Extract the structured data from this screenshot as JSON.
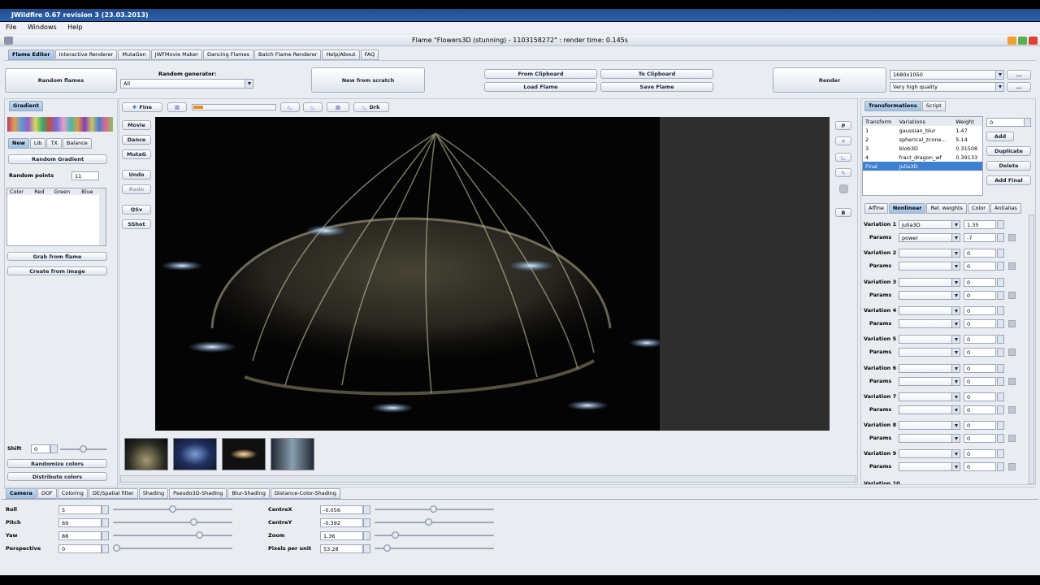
{
  "window": {
    "title": "JWildfire 0.67 revision 3 (23.03.2013)",
    "frame_title": "Flame \"Flowers3D (stunning) - 1103158272\" : render time: 0.145s"
  },
  "menu": [
    "File",
    "Windows",
    "Help"
  ],
  "main_tabs": [
    "Flame Editor",
    "Interactive Renderer",
    "MutaGen",
    "JWFMovie Maker",
    "Dancing Flames",
    "Batch Flame Renderer",
    "Help/About",
    "FAQ"
  ],
  "top": {
    "random_flames": "Random flames",
    "random_generator_label": "Random generator:",
    "random_generator_value": "All",
    "new_from_scratch": "New from scratch",
    "from_clipboard": "From Clipboard",
    "to_clipboard": "To Clipboard",
    "load_flame": "Load Flame",
    "save_flame": "Save Flame",
    "render": "Render",
    "resolution": "1680x1050",
    "quality": "Very high quality",
    "ellipsis": "..."
  },
  "gradient": {
    "tab": "Gradient",
    "subtabs": [
      "New",
      "Lib",
      "TX",
      "Balance"
    ],
    "random_gradient": "Random Gradient",
    "random_points_label": "Random points",
    "random_points_value": "11",
    "columns": [
      "Color",
      "Red",
      "Green",
      "Blue"
    ],
    "grab_from_flame": "Grab from flame",
    "create_from_image": "Create from image",
    "shift_label": "Shift",
    "shift_value": "0",
    "randomize_colors": "Randomize colors",
    "distribute_colors": "Distribute colors"
  },
  "toolbar": {
    "fine": "Fine",
    "drk": "Drk"
  },
  "sidebuttons": [
    "Movie",
    "Dance",
    "MutaG",
    "Undo",
    "Redo",
    "QSv",
    "SShot"
  ],
  "right_icons": {
    "p": "P",
    "b": "B"
  },
  "transforms": {
    "tabs": [
      "Transformations",
      "Script"
    ],
    "columns": [
      "Transform",
      "Variations",
      "Weight"
    ],
    "rows": [
      [
        "1",
        "gaussian_blur",
        "1.47"
      ],
      [
        "2",
        "spherical_zcone...",
        "5.14"
      ],
      [
        "3",
        "blob3D",
        "0.31508"
      ],
      [
        "4",
        "fract_dragon_wf",
        "0.39133"
      ],
      [
        "Final",
        "julia3D",
        ""
      ]
    ],
    "spinner_value": "0",
    "add": "Add",
    "duplicate": "Duplicate",
    "delete": "Delete",
    "add_final": "Add Final"
  },
  "var_tabs": [
    "Affine",
    "Nonlinear",
    "Rel. weights",
    "Color",
    "Antialias"
  ],
  "variations": [
    {
      "label": "Variation 1",
      "name": "julia3D",
      "value": "1.35",
      "params_label": "Params",
      "param_name": "power",
      "param_value": "-7"
    },
    {
      "label": "Variation 2",
      "name": "",
      "value": "0",
      "params_label": "Params",
      "param_name": "",
      "param_value": "0"
    },
    {
      "label": "Variation 3",
      "name": "",
      "value": "0",
      "params_label": "Params",
      "param_name": "",
      "param_value": "0"
    },
    {
      "label": "Variation 4",
      "name": "",
      "value": "0",
      "params_label": "Params",
      "param_name": "",
      "param_value": "0"
    },
    {
      "label": "Variation 5",
      "name": "",
      "value": "0",
      "params_label": "Params",
      "param_name": "",
      "param_value": "0"
    },
    {
      "label": "Variation 6",
      "name": "",
      "value": "0",
      "params_label": "Params",
      "param_name": "",
      "param_value": "0"
    },
    {
      "label": "Variation 7",
      "name": "",
      "value": "0",
      "params_label": "Params",
      "param_name": "",
      "param_value": "0"
    },
    {
      "label": "Variation 8",
      "name": "",
      "value": "0",
      "params_label": "Params",
      "param_name": "",
      "param_value": "0"
    },
    {
      "label": "Variation 9",
      "name": "",
      "value": "0",
      "params_label": "Params",
      "param_name": "",
      "param_value": "0"
    }
  ],
  "variation_10_partial": "Variation 10",
  "bottom_tabs": [
    "Camera",
    "DOF",
    "Coloring",
    "DE/Spatial filter",
    "Shading",
    "Pseudo3D-Shading",
    "Blur-Shading",
    "Distance-Color-Shading"
  ],
  "camera": {
    "left": [
      {
        "label": "Roll",
        "value": "5",
        "level": 0.5
      },
      {
        "label": "Pitch",
        "value": "69",
        "level": 0.69
      },
      {
        "label": "Yaw",
        "value": "88",
        "level": 0.74
      },
      {
        "label": "Perspective",
        "value": "0",
        "level": 0.0
      }
    ],
    "right": [
      {
        "label": "CentreX",
        "value": "-0.056",
        "level": 0.49
      },
      {
        "label": "CentreY",
        "value": "-0.392",
        "level": 0.45
      },
      {
        "label": "Zoom",
        "value": "1.36",
        "level": 0.15
      },
      {
        "label": "Pixels per unit",
        "value": "53.28",
        "level": 0.08
      }
    ]
  }
}
